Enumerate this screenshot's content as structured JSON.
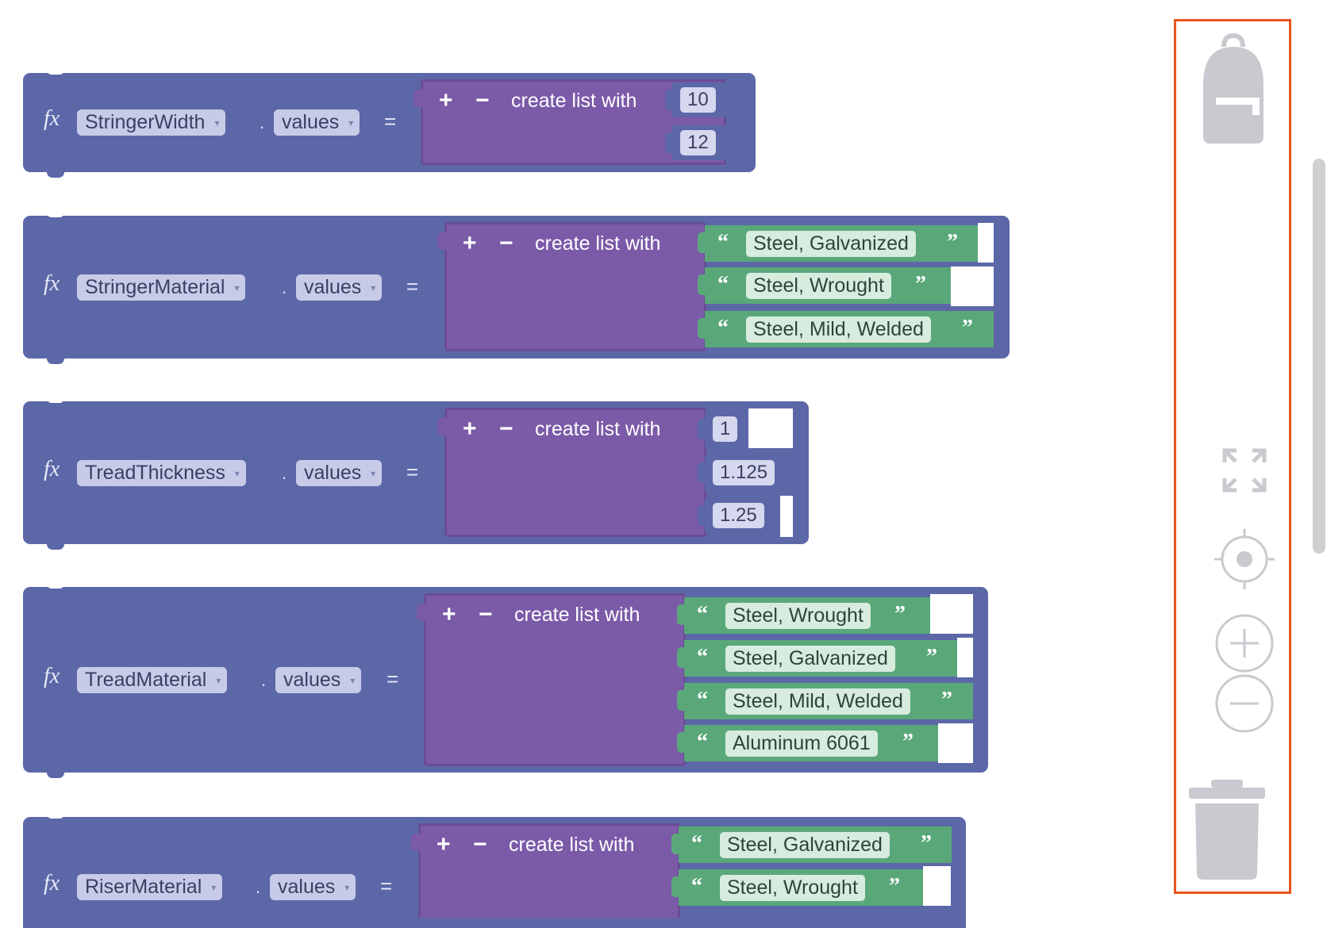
{
  "workspace": {
    "blocks": [
      {
        "variable": "StringerWidth",
        "property": "values",
        "operator": "=",
        "list": {
          "plus": "+",
          "minus": "−",
          "label": "create list with",
          "items": [
            "10",
            "12"
          ]
        }
      },
      {
        "variable": "StringerMaterial",
        "property": "values",
        "operator": "=",
        "list": {
          "plus": "+",
          "minus": "−",
          "label": "create list with",
          "items": [
            "Steel, Galvanized",
            "Steel, Wrought",
            "Steel, Mild, Welded"
          ]
        }
      },
      {
        "variable": "TreadThickness",
        "property": "values",
        "operator": "=",
        "list": {
          "plus": "+",
          "minus": "−",
          "label": "create list with",
          "items": [
            "1",
            "1.125",
            "1.25"
          ]
        }
      },
      {
        "variable": "TreadMaterial",
        "property": "values",
        "operator": "=",
        "list": {
          "plus": "+",
          "minus": "−",
          "label": "create list with",
          "items": [
            "Steel, Wrought",
            "Steel, Galvanized",
            "Steel, Mild, Welded",
            "Aluminum 6061"
          ]
        }
      },
      {
        "variable": "RiserMaterial",
        "property": "values",
        "operator": "=",
        "list": {
          "plus": "+",
          "minus": "−",
          "label": "create list with",
          "items": [
            "Steel, Galvanized",
            "Steel, Wrought"
          ]
        }
      }
    ],
    "fx_symbol": "fx",
    "separator": ".",
    "open_quote": "“",
    "close_quote": "”",
    "dropdown_glyph": "▾"
  },
  "toolbar": {
    "icons": [
      "backpack-icon",
      "expand-icon",
      "recenter-icon",
      "zoom-in-icon",
      "zoom-out-icon",
      "trash-icon"
    ],
    "highlight_color": "#e8541e"
  },
  "colors": {
    "variable_block": "#5c67a8",
    "list_block": "#7b5aa8",
    "text_block": "#5aa87a"
  }
}
